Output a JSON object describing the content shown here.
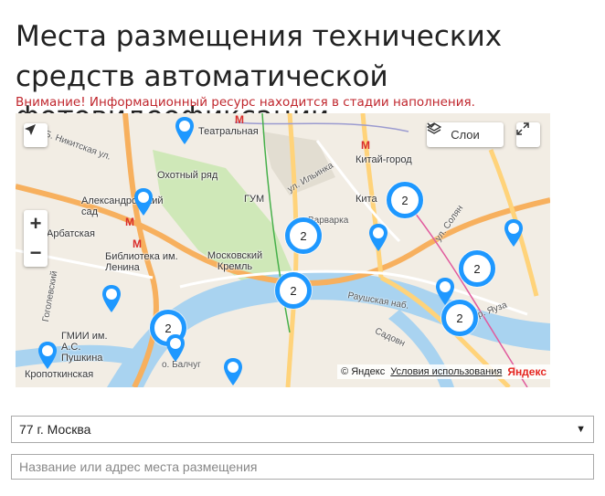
{
  "page": {
    "title": "Места размещения технических средств автоматической фотовидеофиксации",
    "warning": "Внимание! Информационный ресурс находится в стадии наполнения."
  },
  "map": {
    "layers_label": "Слои",
    "zoom_in": "+",
    "zoom_out": "−",
    "copyright": "© Яндекс",
    "terms_link": "Условия использования",
    "logo": "Яндекс",
    "clusters": [
      {
        "count": "2"
      },
      {
        "count": "2"
      },
      {
        "count": "2"
      },
      {
        "count": "2"
      },
      {
        "count": "2"
      },
      {
        "count": "2"
      }
    ],
    "labels": {
      "teatralnaya": "Театральная",
      "okhotny": "Охотный ряд",
      "kitay_gorod": "Китай-город",
      "aleksandrovsky": "Александровский сад",
      "gum": "ГУМ",
      "arbatskaya": "Арбатская",
      "biblioteka": "Библиотека им. Ленина",
      "kreml": "Московский Кремль",
      "gmii": "ГМИИ им. А.С. Пушкина",
      "kropotkinskaya": "Кропоткинская",
      "kita": "Кита",
      "nikitsky": "Б. Никитская ул.",
      "ilyinka": "ул. Ильинка",
      "varvarka": "Варварка",
      "soly": "ул. Солян",
      "raushskaya": "Раушская наб.",
      "yauza": "р. Яуза",
      "valtug": "о. Балчуг",
      "gogolevsky": "Гоголевский",
      "sadovnicheskaya": "Садовн"
    }
  },
  "filters": {
    "region_selected": "77 г. Москва",
    "address_placeholder": "Название или адрес места размещения"
  },
  "colors": {
    "cluster_border": "#1e98ff",
    "warning": "#c0262d",
    "river": "#a9d3f0",
    "road_major": "#ffd37a",
    "road_orange": "#f7b05e"
  }
}
